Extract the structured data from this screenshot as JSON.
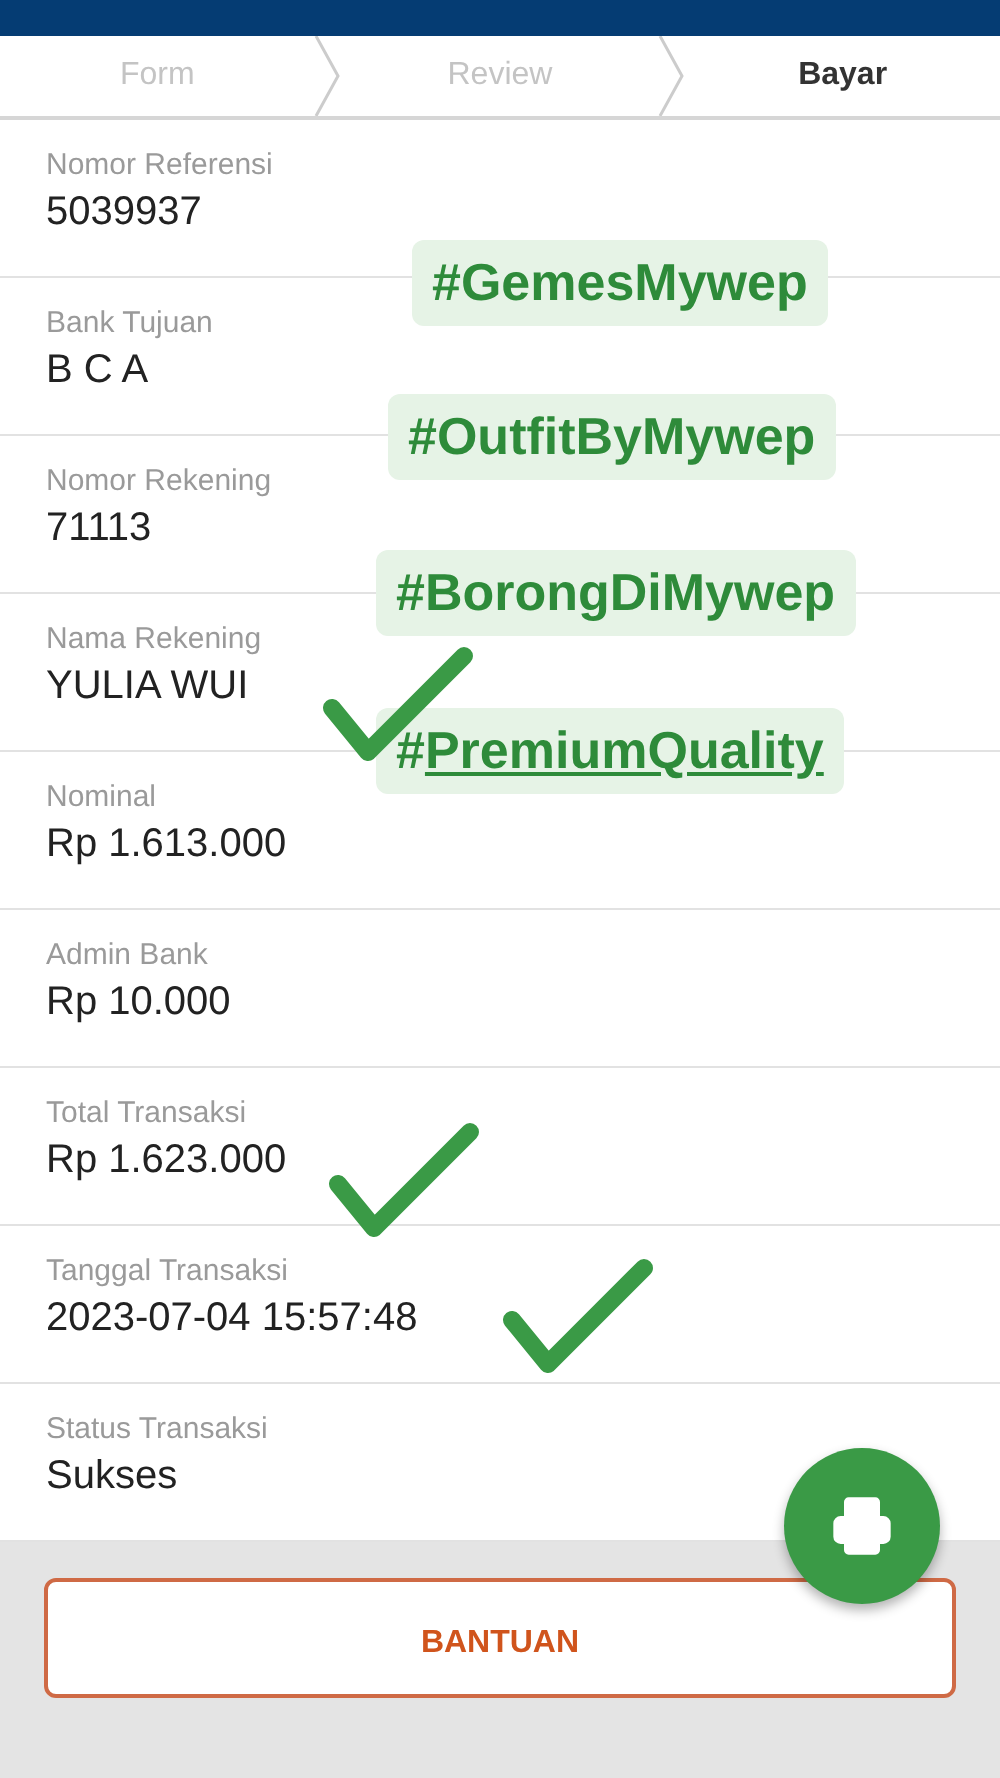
{
  "steps": [
    {
      "label": "Form",
      "selected": false
    },
    {
      "label": "Review",
      "selected": false
    },
    {
      "label": "Bayar",
      "selected": true
    }
  ],
  "details": [
    {
      "label": "Nomor Referensi",
      "value": "5039937"
    },
    {
      "label": "Bank Tujuan",
      "value": "B C A"
    },
    {
      "label": "Nomor Rekening",
      "value": "71113"
    },
    {
      "label": "Nama Rekening",
      "value": "YULIA WUI"
    },
    {
      "label": "Nominal",
      "value": "Rp 1.613.000"
    },
    {
      "label": "Admin Bank",
      "value": "Rp 10.000"
    },
    {
      "label": "Total Transaksi",
      "value": "Rp 1.623.000"
    },
    {
      "label": "Tanggal Transaksi",
      "value": "2023-07-04 15:57:48"
    },
    {
      "label": "Status Transaksi",
      "value": "Sukses"
    }
  ],
  "stickers": [
    {
      "text": "#GemesMywep",
      "underlined": false
    },
    {
      "text": "#OutfitByMywep",
      "underlined": false
    },
    {
      "text": "#BorongDiMywep",
      "underlined": false
    },
    {
      "text": "#PremiumQuality",
      "underlined": true
    }
  ],
  "help_button": "BANTUAN"
}
